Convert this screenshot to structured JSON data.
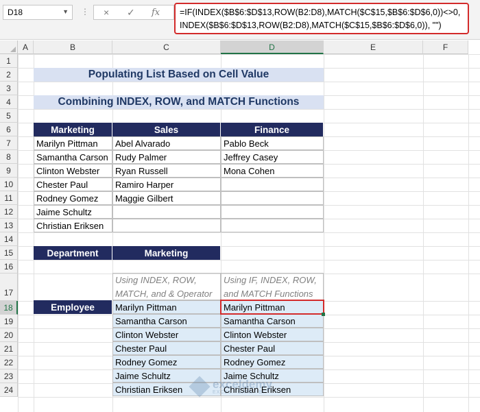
{
  "formula_bar": {
    "name_box": "D18",
    "cancel_icon": "×",
    "enter_icon": "✓",
    "fx_label": "fx",
    "formula_line1": "=IF(INDEX($B$6:$D$13,ROW(B2:D8),MATCH($C$15,$B$6:$D$6,0))<>0,",
    "formula_line2": "INDEX($B$6:$D$13,ROW(B2:D8),MATCH($C$15,$B$6:$D$6,0)), \"\")"
  },
  "columns": [
    "A",
    "B",
    "C",
    "D",
    "E",
    "F"
  ],
  "rows": [
    "1",
    "2",
    "3",
    "4",
    "5",
    "6",
    "7",
    "8",
    "9",
    "10",
    "11",
    "12",
    "13",
    "14",
    "15",
    "16",
    "17",
    "18",
    "19",
    "20",
    "21",
    "22",
    "23",
    "24"
  ],
  "sheet": {
    "title1": "Populating List Based on Cell Value",
    "title2": "Combining INDEX, ROW, and MATCH Functions",
    "table_headers": [
      "Marketing",
      "Sales",
      "Finance"
    ],
    "marketing": [
      "Marilyn Pittman",
      "Samantha Carson",
      "Clinton Webster",
      "Chester Paul",
      "Rodney Gomez",
      "Jaime Schultz",
      "Christian Eriksen"
    ],
    "sales": [
      "Abel Alvarado",
      "Rudy Palmer",
      "Ryan Russell",
      "Ramiro Harper",
      "Maggie Gilbert"
    ],
    "finance": [
      "Pablo Beck",
      "Jeffrey Casey",
      "Mona Cohen"
    ],
    "dept_label": "Department",
    "dept_value": "Marketing",
    "employee_label": "Employee",
    "method1_line1": "Using INDEX, ROW,",
    "method1_line2": "MATCH, and & Operator",
    "method2_line1": "Using IF, INDEX, ROW,",
    "method2_line2": "and MATCH Functions",
    "result1": [
      "Marilyn Pittman",
      "Samantha Carson",
      "Clinton Webster",
      "Chester Paul",
      "Rodney Gomez",
      "Jaime Schultz",
      "Christian Eriksen"
    ],
    "result2": [
      "Marilyn Pittman",
      "Samantha Carson",
      "Clinton Webster",
      "Chester Paul",
      "Rodney Gomez",
      "Jaime Schultz",
      "Christian Eriksen"
    ]
  },
  "watermark": {
    "name": "exceldemy",
    "tagline": "EXCEL · DATA · BI"
  },
  "colors": {
    "accent_green": "#217346",
    "header_navy": "#222b5f",
    "title_band": "#d9e1f2",
    "result_fill": "#ddebf7",
    "highlight_red": "#d32a2a"
  }
}
